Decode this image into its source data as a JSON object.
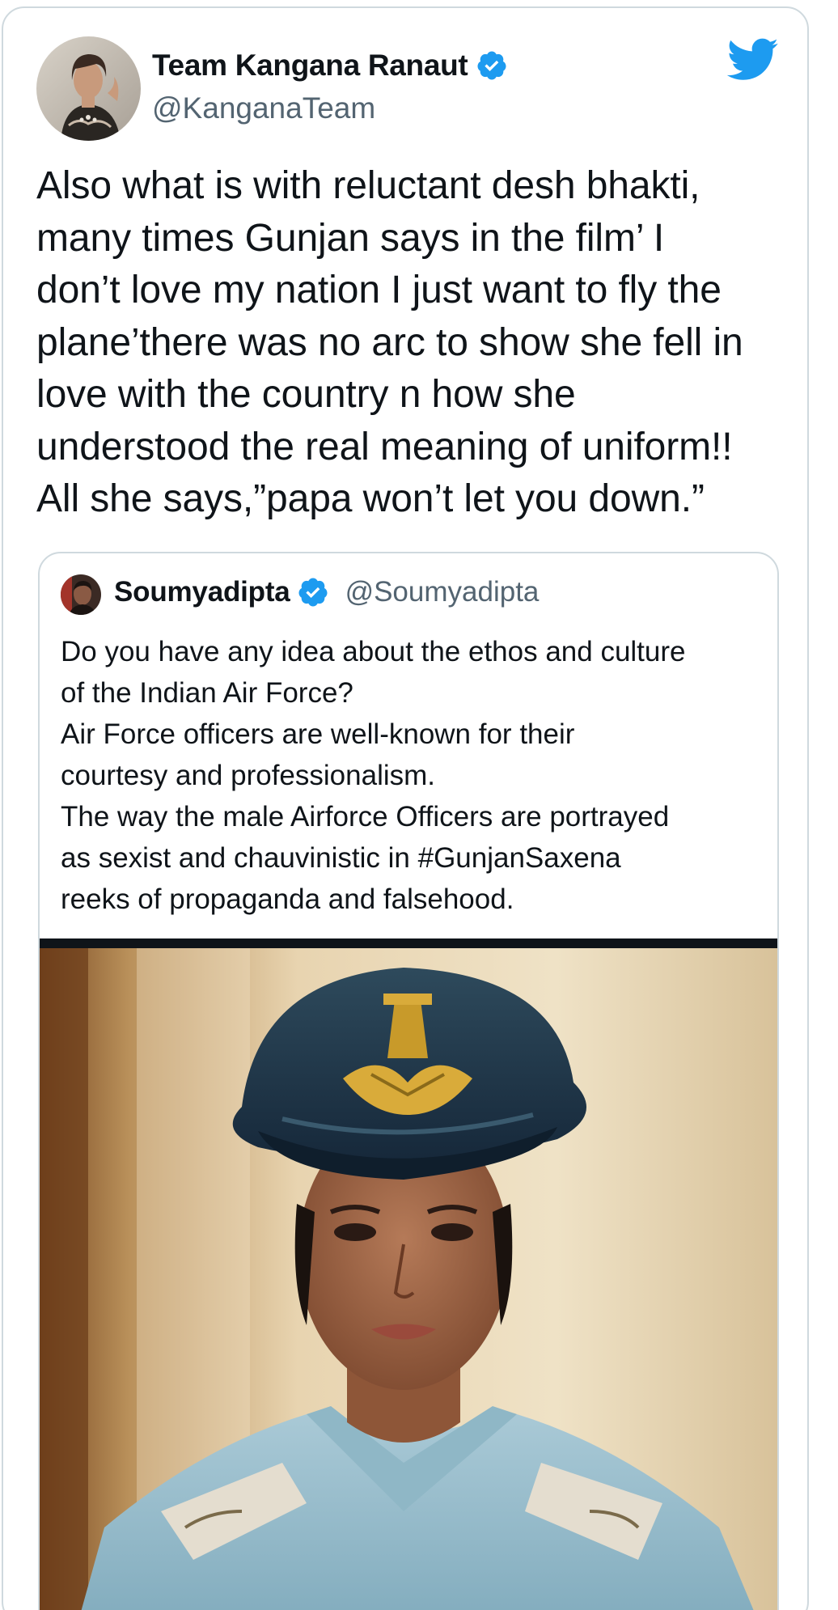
{
  "tweet": {
    "display_name": "Team Kangana Ranaut",
    "handle": "@KanganaTeam",
    "verified": true,
    "text": "Also what is with reluctant desh bhakti,\nmany times Gunjan says in the film’ I\ndon’t love my nation I just want to fly the\nplane’there was no arc to show she fell in\nlove with the country n how she\nunderstood the real meaning of uniform!!\nAll she says,”papa won’t let you down.”",
    "avatar_icon": "profile-photo",
    "brand_icon": "twitter-bird-icon",
    "brand_color": "#1d9bf0"
  },
  "quote": {
    "display_name": "Soumyadipta",
    "handle": "@Soumyadipta",
    "verified": true,
    "text": "Do you have any idea about the ethos and culture\nof the Indian Air Force?\nAir Force officers are well-known for their\ncourtesy and professionalism.\nThe way the male Airforce Officers are portrayed\nas sexist and chauvinistic in #GunjanSaxena\nreeks of propaganda and falsehood.",
    "media_icon": "photo-of-air-force-officer-in-uniform"
  },
  "colors": {
    "text_primary": "#0f1419",
    "text_secondary": "#536471",
    "verified_blue": "#1d9bf0",
    "border": "#cfd9de"
  }
}
